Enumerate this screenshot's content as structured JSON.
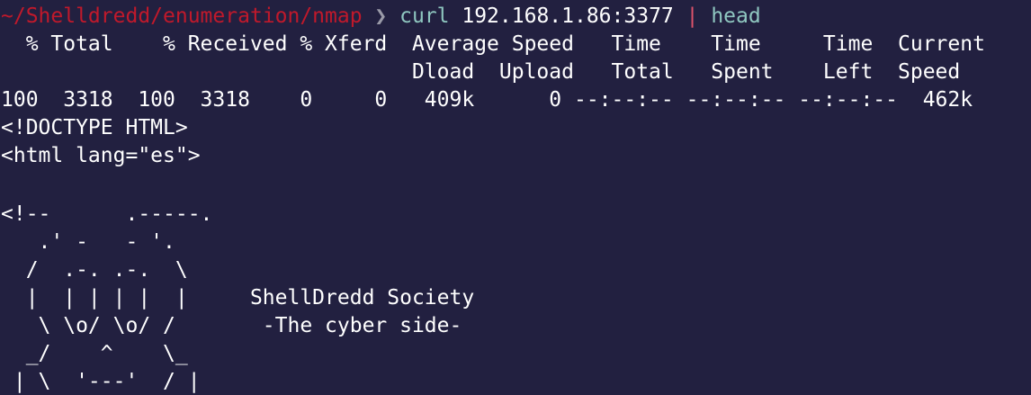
{
  "prompt": {
    "cwd": "~/Shelldredd/enumeration/nmap",
    "separator": " ❯ ",
    "command": "curl",
    "argument": " 192.168.1.86:3377 ",
    "pipe": "|",
    "pipe_command": " head"
  },
  "output": [
    "  % Total    % Received % Xferd  Average Speed   Time    Time     Time  Current",
    "                                 Dload  Upload   Total   Spent    Left  Speed",
    "100  3318  100  3318    0     0   409k      0 --:--:-- --:--:-- --:--:--  462k",
    "<!DOCTYPE HTML>",
    "<html lang=\"es\">",
    "",
    "<!--      .-----.",
    "   .' -   - '.",
    "  /  .-. .-.  \\",
    "  |  | | | |  |     ShellDredd Society",
    "   \\ \\o/ \\o/ /       -The cyber side-",
    "  _/    ^    \\_",
    " | \\  '---'  / |"
  ],
  "colors": {
    "background": "#222040",
    "text": "#ffffff",
    "cwd": "#c0192b",
    "command": "#8fc7c0",
    "pipe": "#e0546b"
  }
}
